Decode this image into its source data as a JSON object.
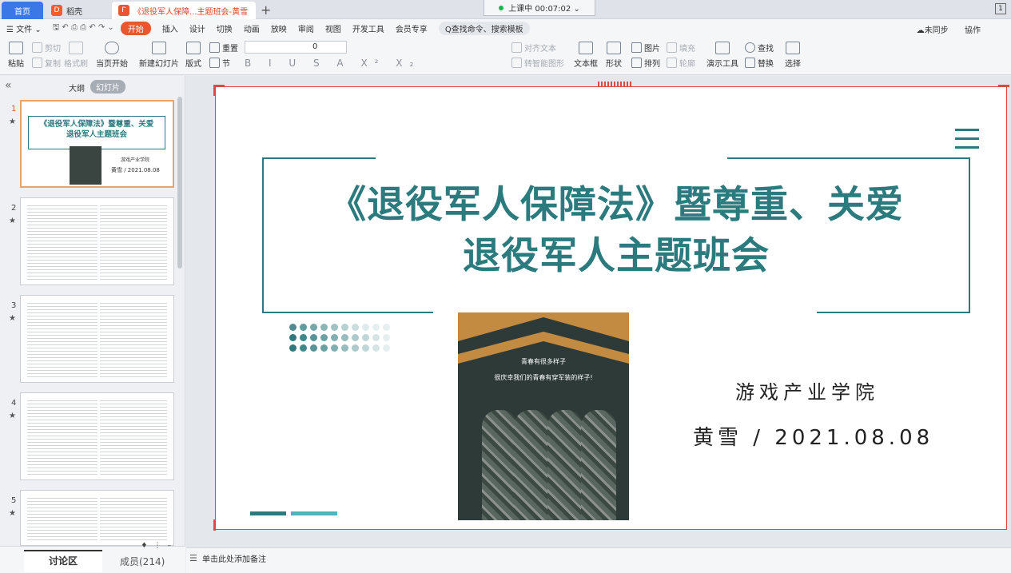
{
  "tabs": {
    "home": "首页",
    "daoke": "稻壳",
    "doc": "《退役军人保障...主题班会-黄雪",
    "new": "+"
  },
  "timer": "上课中 00:07:02 ⌄",
  "menu": {
    "file": "☰ 文件 ⌄",
    "items": [
      "插入",
      "设计",
      "切换",
      "动画",
      "放映",
      "审阅",
      "视图",
      "开发工具",
      "会员专享"
    ],
    "active": "开始",
    "search": "Q查找命令、搜索模板",
    "sync": "☁未同步",
    "collab": "協作"
  },
  "ribbon": {
    "paste": "粘贴",
    "cut": "剪切",
    "copy": "复制",
    "format_painter": "格式刷",
    "slide_start": "当页开始",
    "new_slide": "新建幻灯片",
    "layout": "版式",
    "reset": "重置",
    "section": "节",
    "font_size": "0",
    "textbox": "文本框",
    "shape": "形状",
    "picture": "图片",
    "fill": "填充",
    "arrange": "排列",
    "outline": "轮廓",
    "present_tools": "演示工具",
    "find": "查找",
    "replace": "替换",
    "select": "选择",
    "align_text": "对齐文本",
    "smartart": "转智能图形",
    "format_chars": "B I U S A X² X₂"
  },
  "left_pane": {
    "outline_label": "大纲",
    "slides_label": "幻灯片",
    "slide_numbers": [
      "1",
      "2",
      "3",
      "4",
      "5"
    ],
    "thumb1_title_line1": "《退役军人保障法》暨尊重、关爱",
    "thumb1_title_line2": "退役军人主题班会",
    "thumb1_school": "游戏产业学院",
    "thumb1_author": "黄雪 / 2021.08.08",
    "discussion": "讨论区",
    "members": "成员(214)"
  },
  "slide": {
    "title_line1": "《退役军人保障法》暨尊重、关爱",
    "title_line2": "退役军人主题班会",
    "photo_text1": "青春有很多样子",
    "photo_text2": "很庆幸我们的青春有穿军装的样子!",
    "school": "游戏产业学院",
    "author_date": "黄雪 / 2021.08.08"
  },
  "notes_placeholder": "单击此处添加备注",
  "colors": {
    "accent": "#2b7a7e",
    "light_accent": "#4fb3c2",
    "brand": "#e8572d",
    "gold": "#c28b41"
  }
}
